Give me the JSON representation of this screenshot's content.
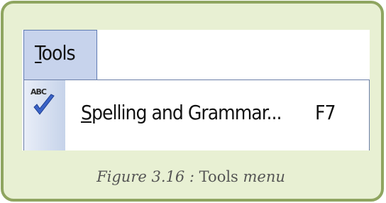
{
  "menubar": {
    "tools_label_mnemonic": "T",
    "tools_label_rest": "ools"
  },
  "tools_menu": {
    "items": [
      {
        "icon": "spelling-grammar-icon",
        "icon_text": "ABC",
        "label_mnemonic": "S",
        "label_rest": "pelling and Grammar...",
        "shortcut": "F7"
      }
    ]
  },
  "caption": {
    "prefix": "Figure 3.16 :",
    "name": "Tools",
    "suffix": "menu"
  },
  "colors": {
    "frame_background": "#e8f0d3",
    "frame_border": "#8fa560",
    "menubar_highlight": "#c7d3ec",
    "menu_border": "#6b7fa8"
  }
}
